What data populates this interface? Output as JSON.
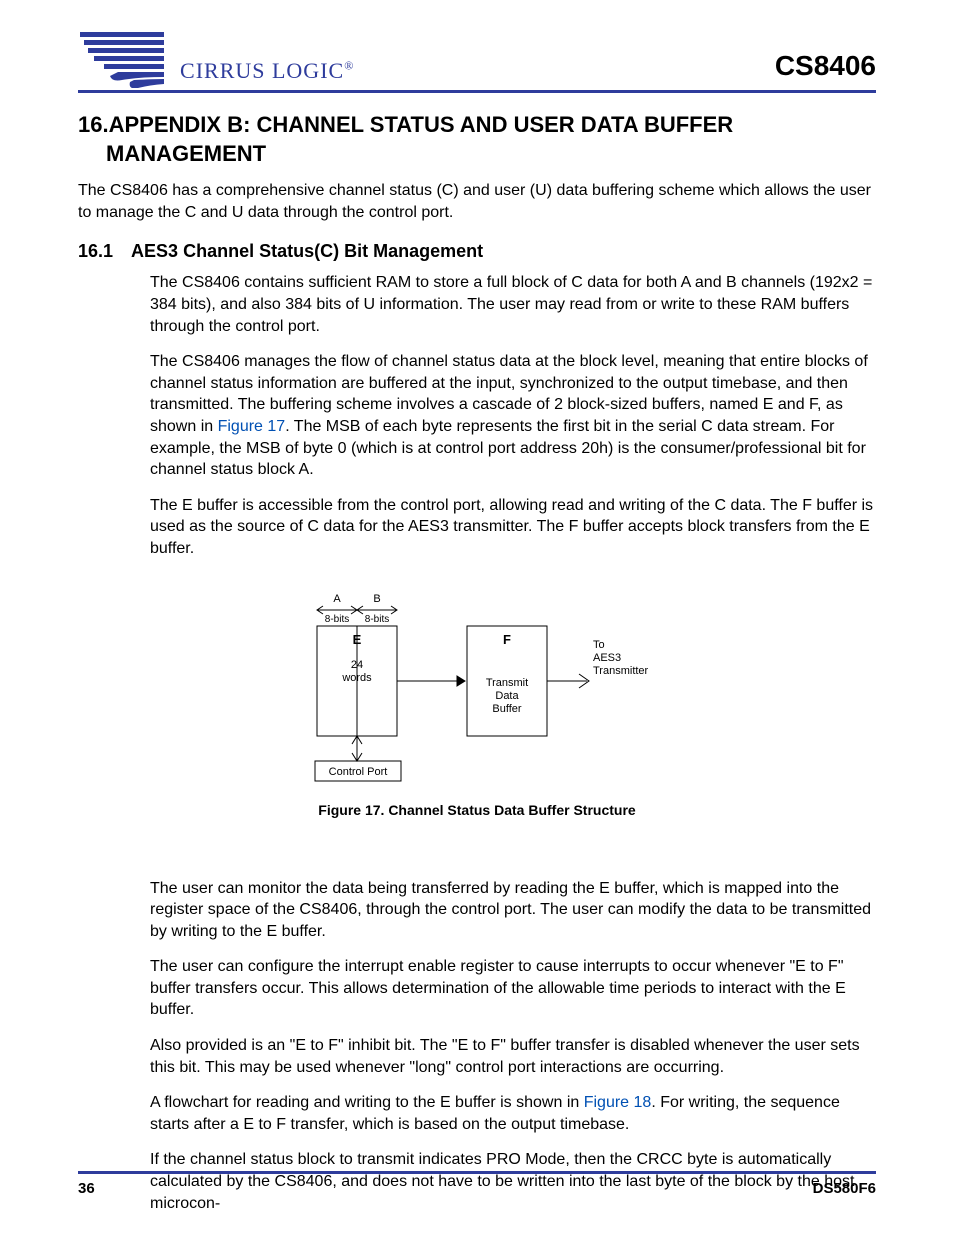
{
  "header": {
    "brand_prefix": "C",
    "brand_rest": "IRRUS LOGIC",
    "doc_id": "CS8406"
  },
  "section": {
    "num": "16.",
    "title_line1": "APPENDIX B: CHANNEL STATUS AND USER DATA BUFFER",
    "title_line2": "MANAGEMENT"
  },
  "intro": "The CS8406 has a comprehensive channel status (C) and user (U) data buffering scheme which allows the user to manage the C and U data through the control port.",
  "sub": {
    "num": "16.1",
    "title": "AES3 Channel Status(C) Bit Management"
  },
  "paragraphs_top": [
    "The CS8406 contains sufficient RAM to store a full block of C data for both A and B channels (192x2 = 384 bits), and also 384 bits of U information. The user may read from or write to these RAM buffers through the control port.",
    "The CS8406 manages the flow of channel status data at the block level, meaning that entire blocks of channel status information are buffered at the input, synchronized to the output timebase, and then transmitted. The buffering scheme involves a cascade of 2 block-sized buffers, named E and F, as shown in {FIG17}. The MSB of each byte represents the first bit in the serial C data stream. For example, the MSB of byte 0 (which is at control port address 20h) is the consumer/professional bit for channel status block A.",
    "The E buffer is accessible from the control port, allowing read and writing of the C data. The F buffer is used as the source of C data for the AES3 transmitter. The F buffer accepts block transfers from the E buffer."
  ],
  "figure": {
    "label_A": "A",
    "label_B": "B",
    "bits_A": "8-bits",
    "bits_B": "8-bits",
    "buf_E": "E",
    "words": "24",
    "words_lbl": "words",
    "buf_F": "F",
    "tx_line1": "Transmit",
    "tx_line2": "Data",
    "tx_line3": "Buffer",
    "to_line1": "To",
    "to_line2": "AES3",
    "to_line3": "Transmitter",
    "ctrl": "Control Port",
    "caption": "Figure 17.  Channel Status Data Buffer Structure"
  },
  "paragraphs_bottom": [
    "The user can monitor the data being transferred by reading the E buffer, which is mapped into the register space of the CS8406, through the control port. The user can modify the data to be transmitted by writing to the E buffer.",
    "The user can configure the interrupt enable register to cause interrupts to occur whenever \"E to F\" buffer transfers occur. This allows determination of the allowable time periods to interact with the E buffer.",
    "Also provided is an \"E to F\" inhibit bit. The \"E to F\" buffer transfer is disabled whenever the user sets this bit. This may be used whenever \"long\" control port interactions are occurring.",
    "A flowchart for reading and writing to the E buffer is shown in {FIG18}. For writing, the sequence starts after a E to F transfer, which is based on the output timebase.",
    "If the channel status block to transmit indicates PRO Mode, then the CRCC byte is automatically calculated by the CS8406, and does not have to be written into the last byte of the block by the host microcon-"
  ],
  "figrefs": {
    "FIG17": "Figure 17",
    "FIG18": "Figure 18"
  },
  "footer": {
    "page": "36",
    "doc": "DS580F6"
  }
}
